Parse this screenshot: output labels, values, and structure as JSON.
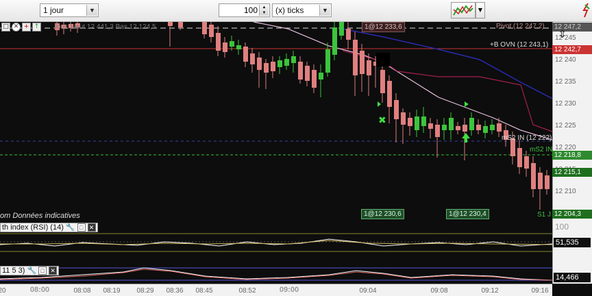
{
  "toolbar": {
    "period": "1 jour",
    "ticks_value": "100",
    "ticks_unit": "(x) ticks"
  },
  "chart": {
    "header_text": "Jour: Haut 12 441,3  Bas 12 124,5",
    "disclaimer": "om  Données indicatives",
    "pivot_label": "Pivot (12 247,2)",
    "ovn_label": "+B OVN (12 243,1)",
    "ms2_label": "mS2 IN (12 222)",
    "ms2_short": "mS2 IN",
    "s1_label": "S1 J",
    "order_top": "1@12 233,6",
    "order_bot1": "1@12 230,6",
    "order_bot2": "1@12 230,4",
    "tags": {
      "pivot": "12 247,2",
      "price_red": "12 242,7",
      "ms2": "12 218,8",
      "price_green": "12 215,1",
      "s1": "12 204,3"
    },
    "y_ticks": [
      "12 245",
      "12 240",
      "12 235",
      "12 230",
      "12 225",
      "12 220",
      "12 215",
      "12 210"
    ]
  },
  "rsi": {
    "title": "th index (RSI) (14)",
    "value": "51,535",
    "y_tick": "100"
  },
  "stoch": {
    "title": "11 5 3)",
    "value": "14,466"
  },
  "x_axis": {
    "labels": [
      "20",
      "08:00",
      "08:08",
      "08:19",
      "08:29",
      "08:36",
      "08:45",
      "08:52",
      "09:00",
      "09:04",
      "09:08",
      "09:12",
      "09:16"
    ]
  },
  "colors": {
    "up_candle": "#3cc43c",
    "down_candle": "#e08080",
    "ovn_line": "#cc3333",
    "ms2_line": "#2fa02f",
    "pivot_line": "#dddddd"
  }
}
